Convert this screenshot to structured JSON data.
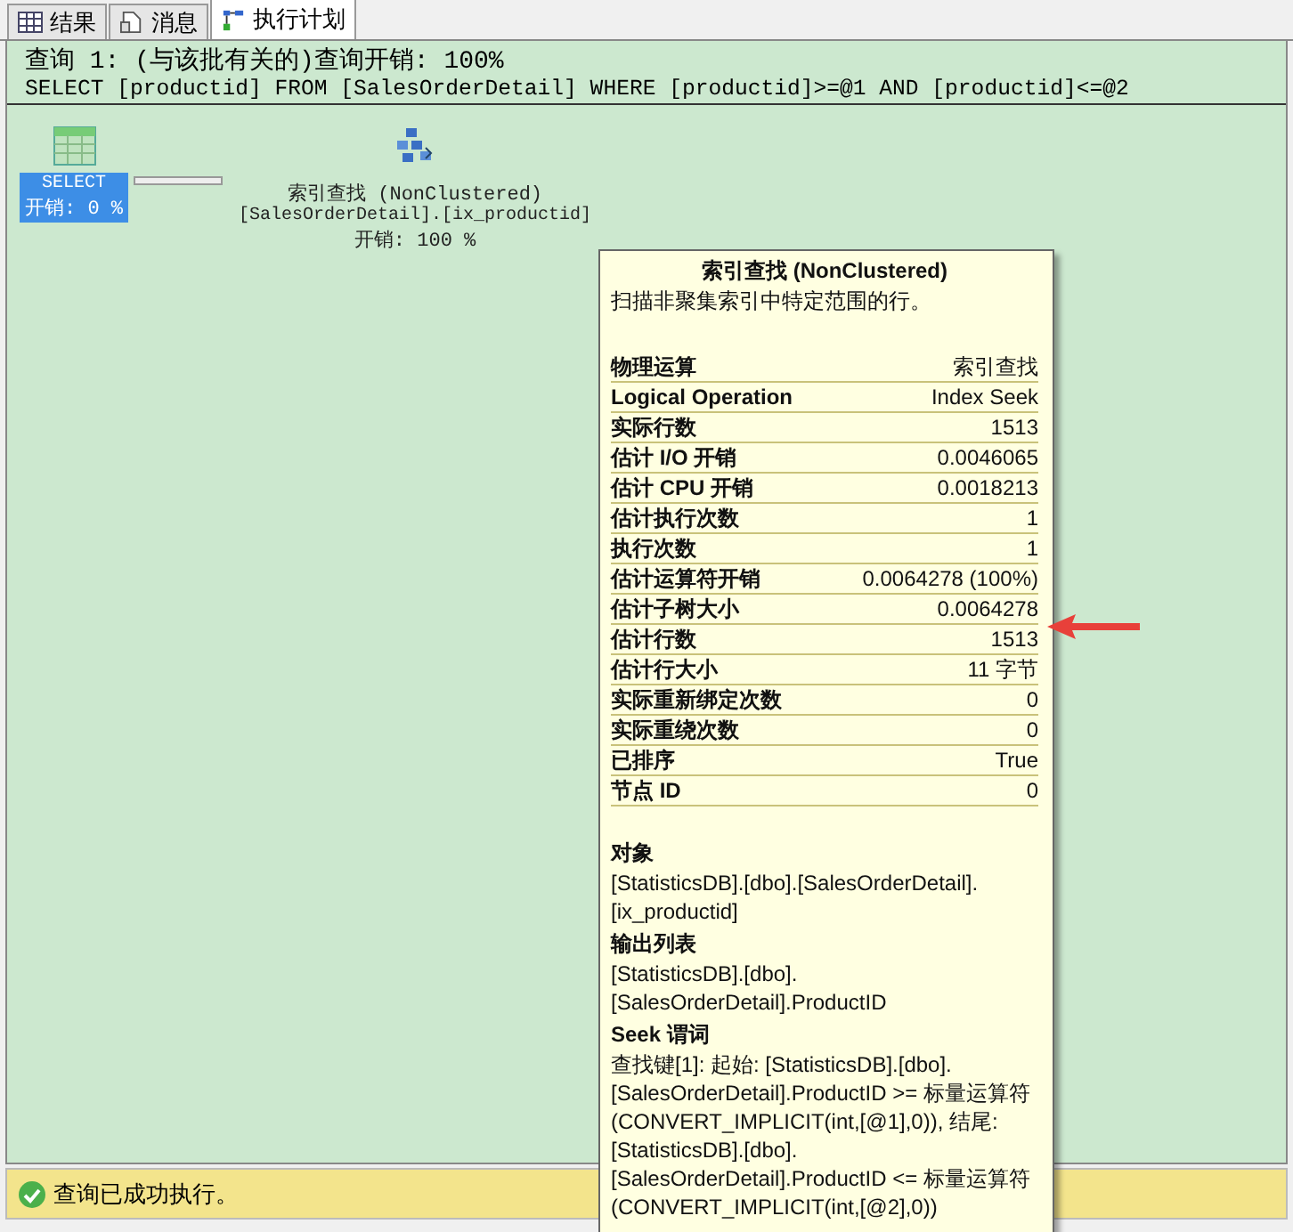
{
  "tabs": [
    {
      "label": "结果",
      "kind": "grid",
      "selected": false
    },
    {
      "label": "消息",
      "kind": "messages",
      "selected": false
    },
    {
      "label": "执行计划",
      "kind": "plan",
      "selected": true
    }
  ],
  "query": {
    "header": "查询 1: (与该批有关的)查询开销: 100%",
    "sql": "SELECT [productid] FROM [SalesOrderDetail] WHERE [productid]>=@1 AND [productid]<=@2"
  },
  "plan_nodes": [
    {
      "kind": "select",
      "title": "SELECT",
      "cost": "开销: 0 %",
      "selected": true
    },
    {
      "kind": "index_seek",
      "title": "索引查找 (NonClustered)",
      "object": "[SalesOrderDetail].[ix_productid]",
      "cost": "开销: 100 %",
      "selected": false
    }
  ],
  "tooltip": {
    "title": "索引查找 (NonClustered)",
    "description": "扫描非聚集索引中特定范围的行。",
    "properties": [
      {
        "name": "物理运算",
        "value": "索引查找"
      },
      {
        "name": "Logical Operation",
        "value": "Index Seek"
      },
      {
        "name": "实际行数",
        "value": "1513"
      },
      {
        "name": "估计 I/O 开销",
        "value": "0.0046065"
      },
      {
        "name": "估计 CPU 开销",
        "value": "0.0018213"
      },
      {
        "name": "估计执行次数",
        "value": "1"
      },
      {
        "name": "执行次数",
        "value": "1"
      },
      {
        "name": "估计运算符开销",
        "value": "0.0064278 (100%)"
      },
      {
        "name": "估计子树大小",
        "value": "0.0064278"
      },
      {
        "name": "估计行数",
        "value": "1513"
      },
      {
        "name": "估计行大小",
        "value": "11 字节"
      },
      {
        "name": "实际重新绑定次数",
        "value": "0"
      },
      {
        "name": "实际重绕次数",
        "value": "0"
      },
      {
        "name": "已排序",
        "value": "True"
      },
      {
        "name": "节点 ID",
        "value": "0"
      }
    ],
    "sections": [
      {
        "heading": "对象",
        "text": "[StatisticsDB].[dbo].[SalesOrderDetail].[ix_productid]"
      },
      {
        "heading": "输出列表",
        "text": "[StatisticsDB].[dbo].[SalesOrderDetail].ProductID"
      },
      {
        "heading": "Seek 谓词",
        "text": "查找键[1]: 起始: [StatisticsDB].[dbo].[SalesOrderDetail].ProductID >= 标量运算符(CONVERT_IMPLICIT(int,[@1],0)), 结尾: [StatisticsDB].[dbo].[SalesOrderDetail].ProductID <= 标量运算符(CONVERT_IMPLICIT(int,[@2],0))"
      }
    ]
  },
  "status_bar": {
    "message": "查询已成功执行。"
  }
}
